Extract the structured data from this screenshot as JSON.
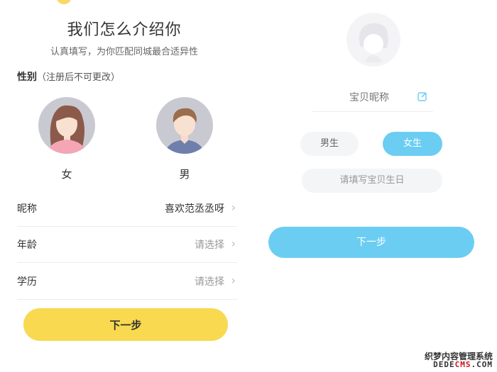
{
  "left": {
    "title": "我们怎么介绍你",
    "subtitle": "认真填写，为你匹配同城最合适异性",
    "gender_label": "性别",
    "gender_note": "（注册后不可更改）",
    "female_label": "女",
    "male_label": "男",
    "rows": [
      {
        "label": "昵称",
        "value": "喜欢范丞丞呀"
      },
      {
        "label": "年龄",
        "value": "请选择"
      },
      {
        "label": "学历",
        "value": "请选择"
      }
    ],
    "next_button": "下一步"
  },
  "right": {
    "nickname_placeholder": "宝贝昵称",
    "male_option": "男生",
    "female_option": "女生",
    "selected_gender": "女生",
    "birthday_placeholder": "请填写宝贝生日",
    "next_button": "下一步"
  },
  "watermark": {
    "line1": "织梦内容管理系统",
    "line2_prefix": "DEDE",
    "line2_highlight": "CMS",
    "line2_suffix": ".COM"
  },
  "colors": {
    "yellow_accent": "#f8d94f",
    "blue_accent": "#6ccdf3",
    "avatar_bg": "#c9c9d1"
  }
}
